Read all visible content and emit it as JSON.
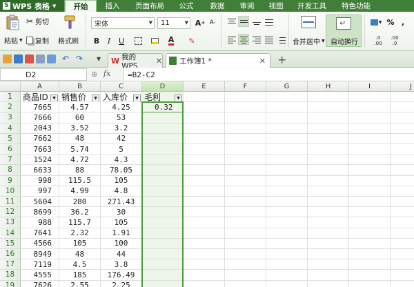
{
  "app": {
    "name": "WPS 表格",
    "logo": "S"
  },
  "menu": {
    "tabs": [
      "开始",
      "插入",
      "页面布局",
      "公式",
      "数据",
      "审阅",
      "视图",
      "开发工具",
      "特色功能"
    ]
  },
  "ribbon": {
    "paste_label": "粘贴",
    "cut_label": "剪切",
    "copy_label": "复制",
    "format_painter_label": "格式刷",
    "font_name": "宋体",
    "font_size": "11",
    "bold": "B",
    "italic": "I",
    "underline": "U",
    "merge_center_label": "合并居中",
    "wrap_text_label": "自动换行",
    "percent_symbol": "%",
    "comma_symbol": ",",
    "increase_decimal": ".0\n.00",
    "decrease_decimal": ".00\n.0",
    "font_grow": "A",
    "font_shrink": "A"
  },
  "doc_tabs": [
    {
      "label": "我的WPS"
    },
    {
      "label": "工作簿1 *"
    }
  ],
  "formula_bar": {
    "cell_ref": "D2",
    "fx": "fx",
    "formula": "=B2-C2"
  },
  "grid": {
    "columns": [
      "A",
      "B",
      "C",
      "D",
      "E",
      "F",
      "G",
      "H",
      "I",
      "J"
    ],
    "rows": [
      "1",
      "2",
      "3",
      "4",
      "5",
      "6",
      "7",
      "8",
      "9",
      "10",
      "11",
      "12",
      "13",
      "14",
      "15",
      "16",
      "17",
      "18",
      "19"
    ],
    "headers": [
      "商品ID",
      "销售价",
      "入库价",
      "毛利"
    ],
    "data": [
      [
        "7665",
        "4.57",
        "4.25",
        "0.32"
      ],
      [
        "7666",
        "60",
        "53",
        ""
      ],
      [
        "2043",
        "3.52",
        "3.2",
        ""
      ],
      [
        "7662",
        "48",
        "42",
        ""
      ],
      [
        "7663",
        "5.74",
        "5",
        ""
      ],
      [
        "1524",
        "4.72",
        "4.3",
        ""
      ],
      [
        "6633",
        "88",
        "78.05",
        ""
      ],
      [
        "998",
        "115.5",
        "105",
        ""
      ],
      [
        "997",
        "4.99",
        "4.8",
        ""
      ],
      [
        "5604",
        "280",
        "271.43",
        ""
      ],
      [
        "8699",
        "36.2",
        "30",
        ""
      ],
      [
        "988",
        "115.7",
        "105",
        ""
      ],
      [
        "7641",
        "2.32",
        "1.91",
        ""
      ],
      [
        "4566",
        "105",
        "100",
        ""
      ],
      [
        "8949",
        "48",
        "44",
        ""
      ],
      [
        "7119",
        "4.5",
        "3.8",
        ""
      ],
      [
        "4555",
        "185",
        "176.49",
        ""
      ],
      [
        "7626",
        "2.55",
        "2.25",
        ""
      ]
    ]
  },
  "colors": {
    "menu_green": "#3f7f37",
    "selection_green": "#4d9a3f",
    "selected_col_fill": "#eef6e9"
  }
}
